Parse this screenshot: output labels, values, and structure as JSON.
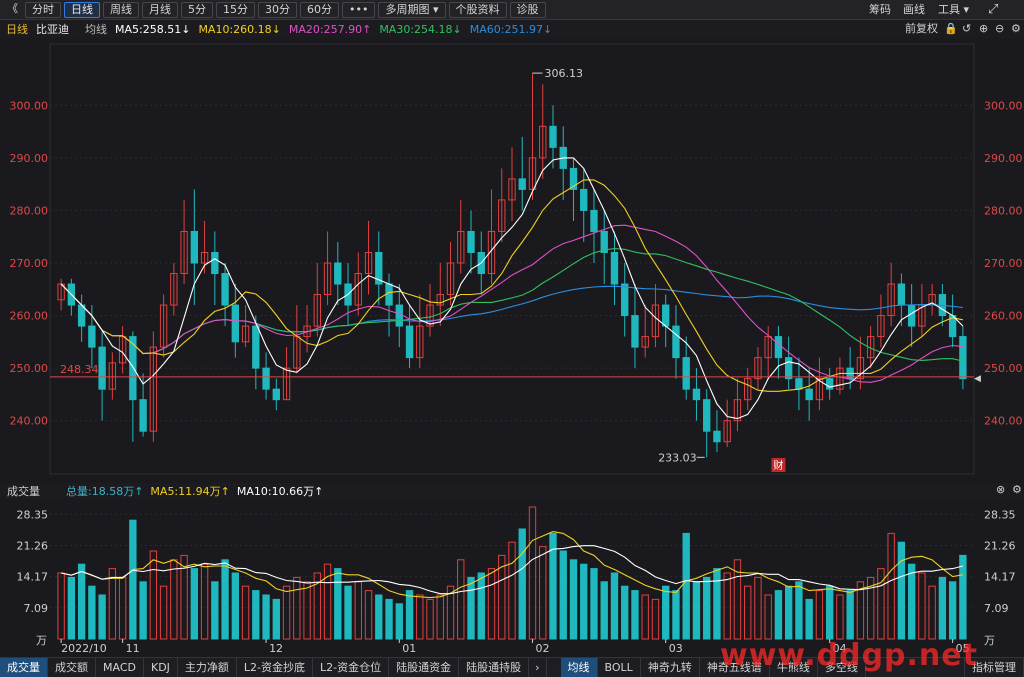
{
  "toolbar": {
    "collapse_icon": "《",
    "periods": [
      "分时",
      "日线",
      "周线",
      "月线",
      "5分",
      "15分",
      "30分",
      "60分"
    ],
    "active_period": "日线",
    "more": "•••",
    "multi_period": "多周期图 ▾",
    "stock_info": "个股资料",
    "diagnose": "诊股",
    "right": {
      "chip": "筹码",
      "draw": "画线",
      "tools": "工具 ▾",
      "expand_icon": "⤢"
    }
  },
  "legend": {
    "period": "日线",
    "stock": "比亚迪",
    "ma_label": "均线",
    "ma5": "MA5:258.51↓",
    "ma10": "MA10:260.18↓",
    "ma20": "MA20:257.90↑",
    "ma30": "MA30:254.18↓",
    "ma60": "MA60:251.97↓",
    "adjust": "前复权",
    "colors": {
      "ma5": "#ffffff",
      "ma10": "#f0d020",
      "ma20": "#e050c8",
      "ma30": "#30c060",
      "ma60": "#2a8ee0"
    }
  },
  "volume_panel": {
    "title": "成交量",
    "total": "总量:18.58万↑",
    "ma5": "MA5:11.94万↑",
    "ma10": "MA10:10.66万↑",
    "yticks": [
      "28.35",
      "21.26",
      "14.17",
      "7.09",
      "万"
    ]
  },
  "bottom_tabs_left": [
    "成交量",
    "成交额",
    "MACD",
    "KDJ",
    "主力净额",
    "L2-资金抄底",
    "L2-资金仓位",
    "陆股通资金",
    "陆股通持股"
  ],
  "bottom_tabs_right": [
    "均线",
    "BOLL",
    "神奇九转",
    "神奇五线谱",
    "牛熊线",
    "多空线",
    "指标管理"
  ],
  "watermark": "www.ddgp.net",
  "chart_data": [
    {
      "type": "candlestick",
      "title": "",
      "y_ticks": [
        "300.00",
        "290.00",
        "280.00",
        "270.00",
        "260.00",
        "250.00",
        "240.00"
      ],
      "ylim": [
        231,
        309
      ],
      "x_labels": [
        "2022/10",
        "11",
        "12",
        "01",
        "02",
        "03",
        "04",
        "05"
      ],
      "annotations": {
        "high": "306.13",
        "low": "233.03",
        "ref_line": "248.34",
        "fin_marker": "财"
      },
      "ref_line_value": 248.34,
      "colors": {
        "up": "#e0403f",
        "down": "#1fb8bf",
        "ref": "#e04848"
      },
      "candles": [
        [
          263,
          266,
          261,
          267
        ],
        [
          266,
          262,
          260,
          267
        ],
        [
          262,
          258,
          255,
          264
        ],
        [
          258,
          254,
          250,
          262
        ],
        [
          254,
          246,
          240,
          257
        ],
        [
          246,
          251,
          244,
          253
        ],
        [
          251,
          256,
          249,
          258
        ],
        [
          256,
          244,
          236,
          257
        ],
        [
          244,
          238,
          237,
          249
        ],
        [
          238,
          254,
          236,
          257
        ],
        [
          254,
          262,
          252,
          264
        ],
        [
          262,
          268,
          260,
          270
        ],
        [
          268,
          276,
          266,
          282
        ],
        [
          276,
          270,
          262,
          284
        ],
        [
          270,
          272,
          268,
          278
        ],
        [
          272,
          268,
          262,
          276
        ],
        [
          268,
          262,
          258,
          270
        ],
        [
          262,
          255,
          252,
          266
        ],
        [
          255,
          258,
          254,
          262
        ],
        [
          258,
          250,
          246,
          260
        ],
        [
          250,
          246,
          244,
          253
        ],
        [
          246,
          244,
          242,
          248
        ],
        [
          244,
          250,
          244,
          254
        ],
        [
          250,
          256,
          249,
          262
        ],
        [
          256,
          258,
          253,
          262
        ],
        [
          258,
          264,
          256,
          270
        ],
        [
          264,
          270,
          262,
          276
        ],
        [
          270,
          266,
          262,
          274
        ],
        [
          266,
          262,
          258,
          270
        ],
        [
          262,
          268,
          260,
          272
        ],
        [
          268,
          272,
          264,
          278
        ],
        [
          272,
          266,
          262,
          276
        ],
        [
          266,
          262,
          256,
          268
        ],
        [
          262,
          258,
          254,
          266
        ],
        [
          258,
          252,
          250,
          262
        ],
        [
          252,
          258,
          250,
          264
        ],
        [
          258,
          262,
          256,
          266
        ],
        [
          262,
          264,
          258,
          270
        ],
        [
          264,
          270,
          262,
          274
        ],
        [
          270,
          276,
          268,
          282
        ],
        [
          276,
          272,
          268,
          280
        ],
        [
          272,
          268,
          264,
          276
        ],
        [
          268,
          276,
          266,
          284
        ],
        [
          276,
          282,
          274,
          288
        ],
        [
          282,
          286,
          278,
          292
        ],
        [
          286,
          284,
          280,
          294
        ],
        [
          284,
          290,
          282,
          306.13
        ],
        [
          290,
          296,
          286,
          304
        ],
        [
          296,
          292,
          288,
          300
        ],
        [
          292,
          288,
          282,
          296
        ],
        [
          288,
          284,
          278,
          290
        ],
        [
          284,
          280,
          274,
          288
        ],
        [
          280,
          276,
          270,
          284
        ],
        [
          276,
          272,
          266,
          280
        ],
        [
          272,
          266,
          262,
          276
        ],
        [
          266,
          260,
          256,
          270
        ],
        [
          260,
          254,
          250,
          266
        ],
        [
          254,
          256,
          252,
          262
        ],
        [
          256,
          262,
          254,
          266
        ],
        [
          262,
          258,
          254,
          264
        ],
        [
          258,
          252,
          248,
          262
        ],
        [
          252,
          246,
          244,
          256
        ],
        [
          246,
          244,
          240,
          250
        ],
        [
          244,
          238,
          233.03,
          246
        ],
        [
          238,
          236,
          234,
          242
        ],
        [
          236,
          240,
          235,
          244
        ],
        [
          240,
          244,
          238,
          248
        ],
        [
          244,
          248,
          242,
          250
        ],
        [
          248,
          252,
          246,
          254
        ],
        [
          252,
          256,
          248,
          258
        ],
        [
          256,
          252,
          248,
          258
        ],
        [
          252,
          248,
          246,
          256
        ],
        [
          248,
          246,
          242,
          252
        ],
        [
          246,
          244,
          240,
          250
        ],
        [
          244,
          248,
          242,
          252
        ],
        [
          248,
          246,
          244,
          250
        ],
        [
          246,
          250,
          245,
          252
        ],
        [
          250,
          248,
          246,
          254
        ],
        [
          248,
          252,
          246,
          256
        ],
        [
          252,
          256,
          250,
          258
        ],
        [
          256,
          260,
          254,
          264
        ],
        [
          260,
          266,
          258,
          270
        ],
        [
          266,
          262,
          258,
          268
        ],
        [
          262,
          258,
          254,
          266
        ],
        [
          258,
          262,
          256,
          266
        ],
        [
          262,
          264,
          260,
          266
        ],
        [
          264,
          260,
          258,
          266
        ],
        [
          260,
          256,
          254,
          264
        ],
        [
          256,
          248,
          246,
          258
        ]
      ]
    },
    {
      "type": "bar",
      "title": "",
      "ylabel": "万",
      "ylim": [
        0,
        30
      ],
      "y_ticks": [
        28.35,
        21.26,
        14.17,
        7.09
      ],
      "values": [
        15,
        14,
        17,
        12,
        10,
        16,
        14,
        27,
        13,
        20,
        12,
        18,
        19,
        16,
        17,
        13,
        18,
        15,
        12,
        11,
        10,
        9,
        12,
        14,
        13,
        15,
        17,
        16,
        12,
        13,
        11,
        10,
        9,
        8,
        11,
        10,
        9,
        10,
        12,
        18,
        14,
        15,
        16,
        19,
        22,
        25,
        30,
        21,
        24,
        20,
        18,
        17,
        16,
        13,
        15,
        12,
        11,
        10,
        9,
        12,
        11,
        24,
        13,
        14,
        16,
        15,
        18,
        12,
        14,
        10,
        11,
        12,
        13,
        9,
        11,
        12,
        10,
        11,
        13,
        14,
        16,
        24,
        22,
        17,
        15,
        12,
        14,
        13,
        19
      ]
    }
  ]
}
